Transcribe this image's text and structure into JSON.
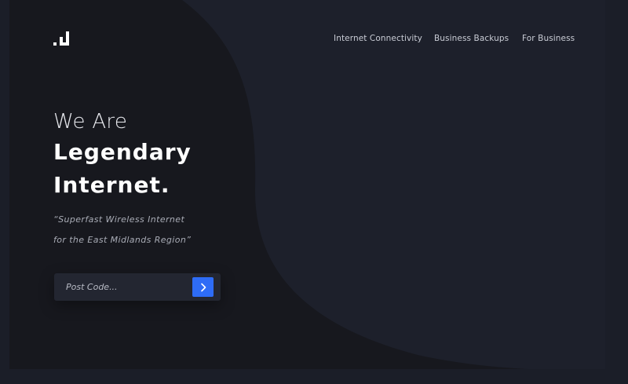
{
  "nav": {
    "items": [
      {
        "label": "Internet Connectivity"
      },
      {
        "label": "Business Backups"
      },
      {
        "label": "For Business"
      }
    ]
  },
  "hero": {
    "intro": "We Are",
    "line1": "Legendary",
    "line2": "Internet.",
    "tagline_1": "“Superfast Wireless Internet",
    "tagline_2": "for the East Midlands Region”"
  },
  "search": {
    "placeholder": "Post Code...",
    "value": ""
  },
  "colors": {
    "page_background": "#1b1e28",
    "panel_background": "#1d202b",
    "curve_background": "#17181e",
    "accent": "#2e6cf6"
  },
  "icons": {
    "logo": "brand-logo-icon",
    "submit": "chevron-right-icon"
  }
}
